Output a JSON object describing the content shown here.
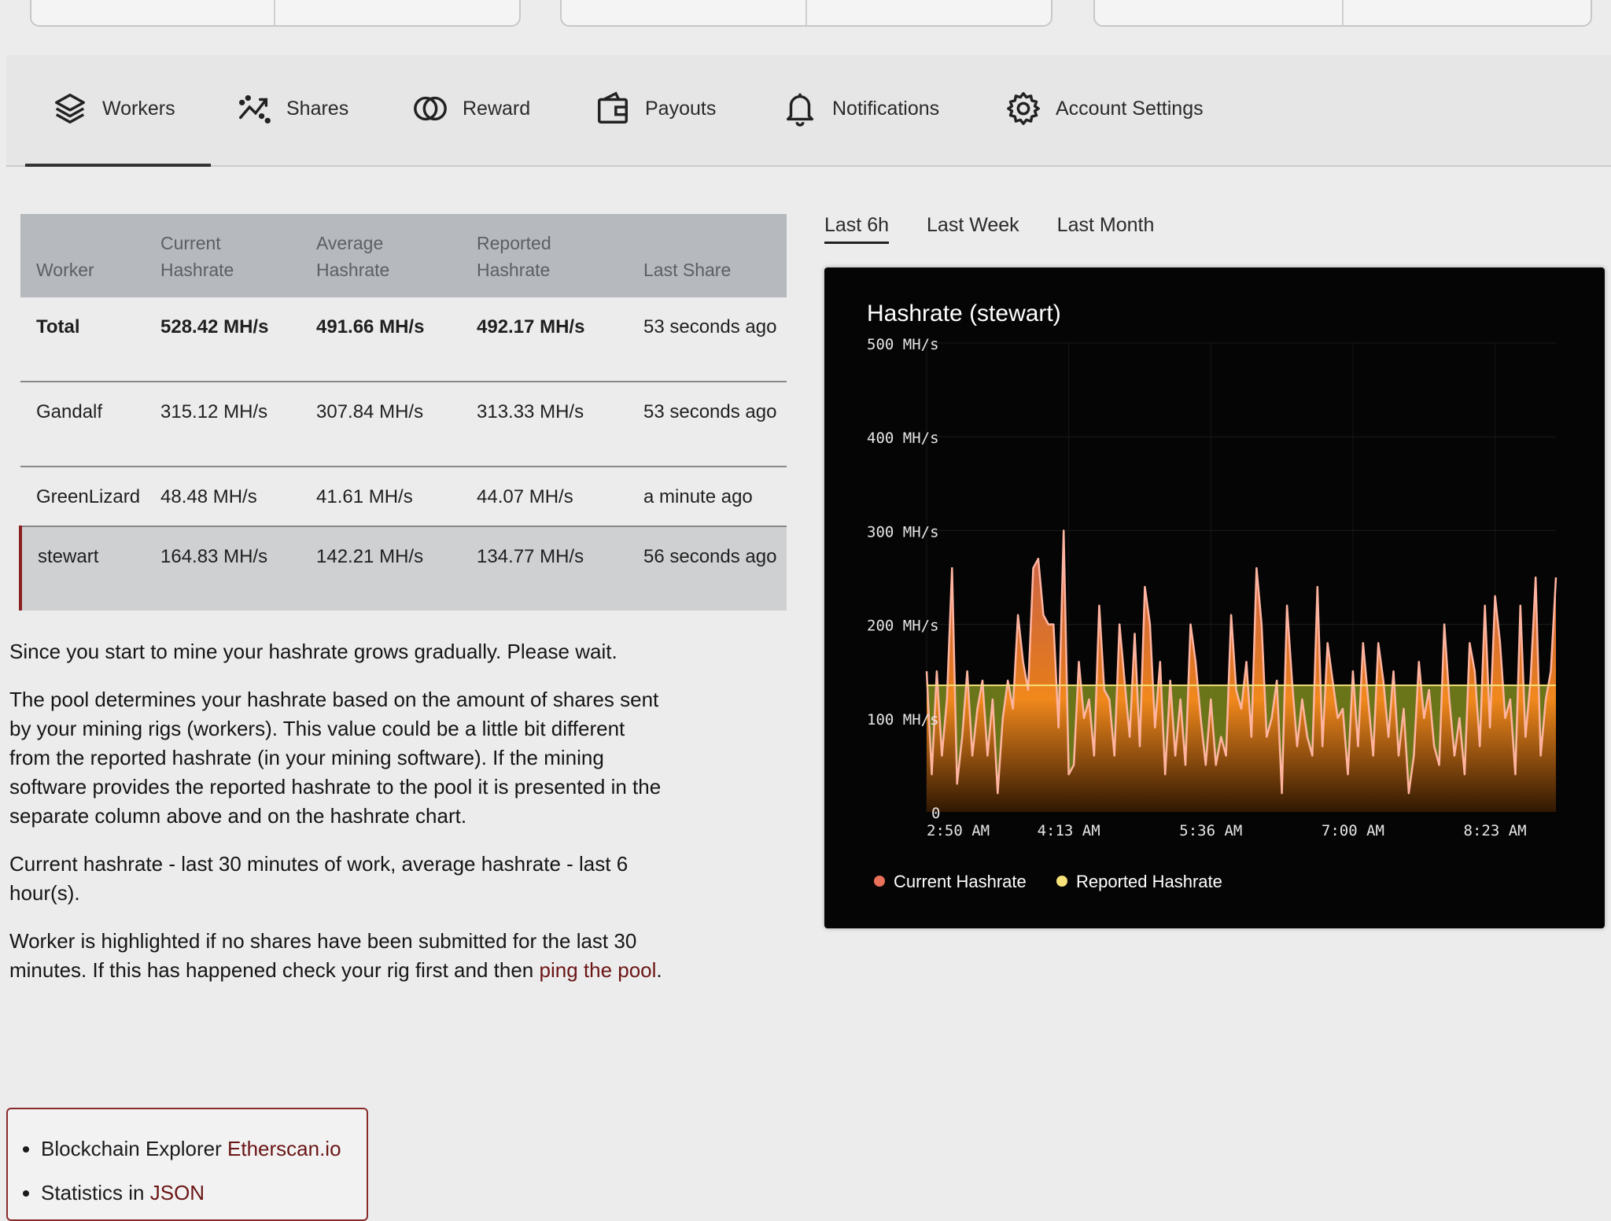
{
  "nav": {
    "items": [
      {
        "label": "Workers",
        "icon": "layers-icon"
      },
      {
        "label": "Shares",
        "icon": "shares-chart-icon"
      },
      {
        "label": "Reward",
        "icon": "coins-icon"
      },
      {
        "label": "Payouts",
        "icon": "wallet-icon"
      },
      {
        "label": "Notifications",
        "icon": "bell-icon"
      },
      {
        "label": "Account Settings",
        "icon": "gear-icon"
      }
    ],
    "active": "Workers"
  },
  "table": {
    "headers": [
      "Worker",
      "Current Hashrate",
      "Average Hashrate",
      "Reported Hashrate",
      "Last Share"
    ],
    "rows": [
      {
        "worker": "Total",
        "current": "528.42 MH/s",
        "average": "491.66 MH/s",
        "reported": "492.17 MH/s",
        "last": "53 seconds ago"
      },
      {
        "worker": "Gandalf",
        "current": "315.12 MH/s",
        "average": "307.84 MH/s",
        "reported": "313.33 MH/s",
        "last": "53 seconds ago"
      },
      {
        "worker": "GreenLizard",
        "current": "48.48 MH/s",
        "average": "41.61 MH/s",
        "reported": "44.07 MH/s",
        "last": "a minute ago"
      },
      {
        "worker": "stewart",
        "current": "164.83 MH/s",
        "average": "142.21 MH/s",
        "reported": "134.77 MH/s",
        "last": "56 seconds ago"
      }
    ]
  },
  "info": {
    "p1": "Since you start to mine your hashrate grows gradually. Please wait.",
    "p2": "The pool determines your hashrate based on the amount of shares sent by your mining rigs (workers). This value could be a little bit different from the reported hashrate (in your mining software). If the mining software provides the reported hashrate to the pool it is presented in the separate column above and on the hashrate chart.",
    "p3": "Current hashrate - last 30 minutes of work, average hashrate - last 6 hour(s).",
    "p4_text": "Worker is highlighted if no shares have been submitted for the last 30 minutes. If this has happened check your rig first and then",
    "p4_link": "ping the pool",
    "p4_end": "."
  },
  "links": {
    "explorer_label": "Blockchain Explorer",
    "explorer_link": "Etherscan.io",
    "stats_label": "Statistics in",
    "stats_link": "JSON"
  },
  "range_tabs": [
    "Last 6h",
    "Last Week",
    "Last Month"
  ],
  "range_active": "Last 6h",
  "chart_data": {
    "type": "area",
    "title": "Hashrate (stewart)",
    "ylim": [
      0,
      500
    ],
    "yticks": [
      0,
      100,
      200,
      300,
      400,
      500
    ],
    "ytick_labels": [
      "0",
      "100 MH/s",
      "200 MH/s",
      "300 MH/s",
      "400 MH/s",
      "500 MH/s"
    ],
    "xlim": [
      0,
      6.2
    ],
    "xticks": [
      0,
      1.4,
      2.8,
      4.2,
      5.6
    ],
    "xtick_labels": [
      "2:50 AM",
      "4:13 AM",
      "5:36 AM",
      "7:00 AM",
      "8:23 AM"
    ],
    "legend_position": "bottom-left",
    "series": [
      {
        "name": "Current Hashrate",
        "color": "#e9705a",
        "x": [
          0.0,
          0.05,
          0.1,
          0.15,
          0.2,
          0.25,
          0.3,
          0.35,
          0.4,
          0.45,
          0.5,
          0.55,
          0.6,
          0.65,
          0.7,
          0.75,
          0.8,
          0.85,
          0.9,
          0.95,
          1.0,
          1.05,
          1.1,
          1.15,
          1.2,
          1.25,
          1.3,
          1.35,
          1.4,
          1.45,
          1.5,
          1.55,
          1.6,
          1.65,
          1.7,
          1.75,
          1.8,
          1.85,
          1.9,
          1.95,
          2.0,
          2.05,
          2.1,
          2.15,
          2.2,
          2.25,
          2.3,
          2.35,
          2.4,
          2.45,
          2.5,
          2.55,
          2.6,
          2.65,
          2.7,
          2.75,
          2.8,
          2.85,
          2.9,
          2.95,
          3.0,
          3.05,
          3.1,
          3.15,
          3.2,
          3.25,
          3.3,
          3.35,
          3.4,
          3.45,
          3.5,
          3.55,
          3.6,
          3.65,
          3.7,
          3.75,
          3.8,
          3.85,
          3.9,
          3.95,
          4.0,
          4.05,
          4.1,
          4.15,
          4.2,
          4.25,
          4.3,
          4.35,
          4.4,
          4.45,
          4.5,
          4.55,
          4.6,
          4.65,
          4.7,
          4.75,
          4.8,
          4.85,
          4.9,
          4.95,
          5.0,
          5.05,
          5.1,
          5.15,
          5.2,
          5.25,
          5.3,
          5.35,
          5.4,
          5.45,
          5.5,
          5.55,
          5.6,
          5.65,
          5.7,
          5.75,
          5.8,
          5.85,
          5.9,
          5.95,
          6.0,
          6.05,
          6.1,
          6.15,
          6.2
        ],
        "values": [
          150,
          40,
          150,
          60,
          120,
          260,
          30,
          80,
          150,
          60,
          110,
          140,
          60,
          120,
          20,
          100,
          140,
          110,
          210,
          160,
          130,
          260,
          270,
          210,
          200,
          200,
          90,
          300,
          40,
          50,
          160,
          100,
          120,
          60,
          220,
          130,
          120,
          60,
          200,
          140,
          80,
          190,
          70,
          240,
          200,
          90,
          160,
          40,
          140,
          60,
          120,
          50,
          200,
          160,
          100,
          50,
          120,
          50,
          80,
          60,
          210,
          130,
          110,
          160,
          80,
          260,
          200,
          80,
          100,
          140,
          20,
          220,
          140,
          70,
          120,
          80,
          60,
          240,
          70,
          180,
          140,
          100,
          110,
          40,
          150,
          70,
          180,
          120,
          60,
          180,
          140,
          80,
          150,
          60,
          110,
          20,
          60,
          160,
          100,
          130,
          70,
          50,
          200,
          120,
          60,
          100,
          40,
          180,
          150,
          70,
          220,
          90,
          230,
          180,
          100,
          120,
          40,
          220,
          80,
          140,
          250,
          60,
          120,
          150,
          250
        ]
      },
      {
        "name": "Reported Hashrate",
        "color": "#f7e27a",
        "x": [
          0.0,
          6.2
        ],
        "values": [
          135,
          135
        ]
      }
    ]
  }
}
